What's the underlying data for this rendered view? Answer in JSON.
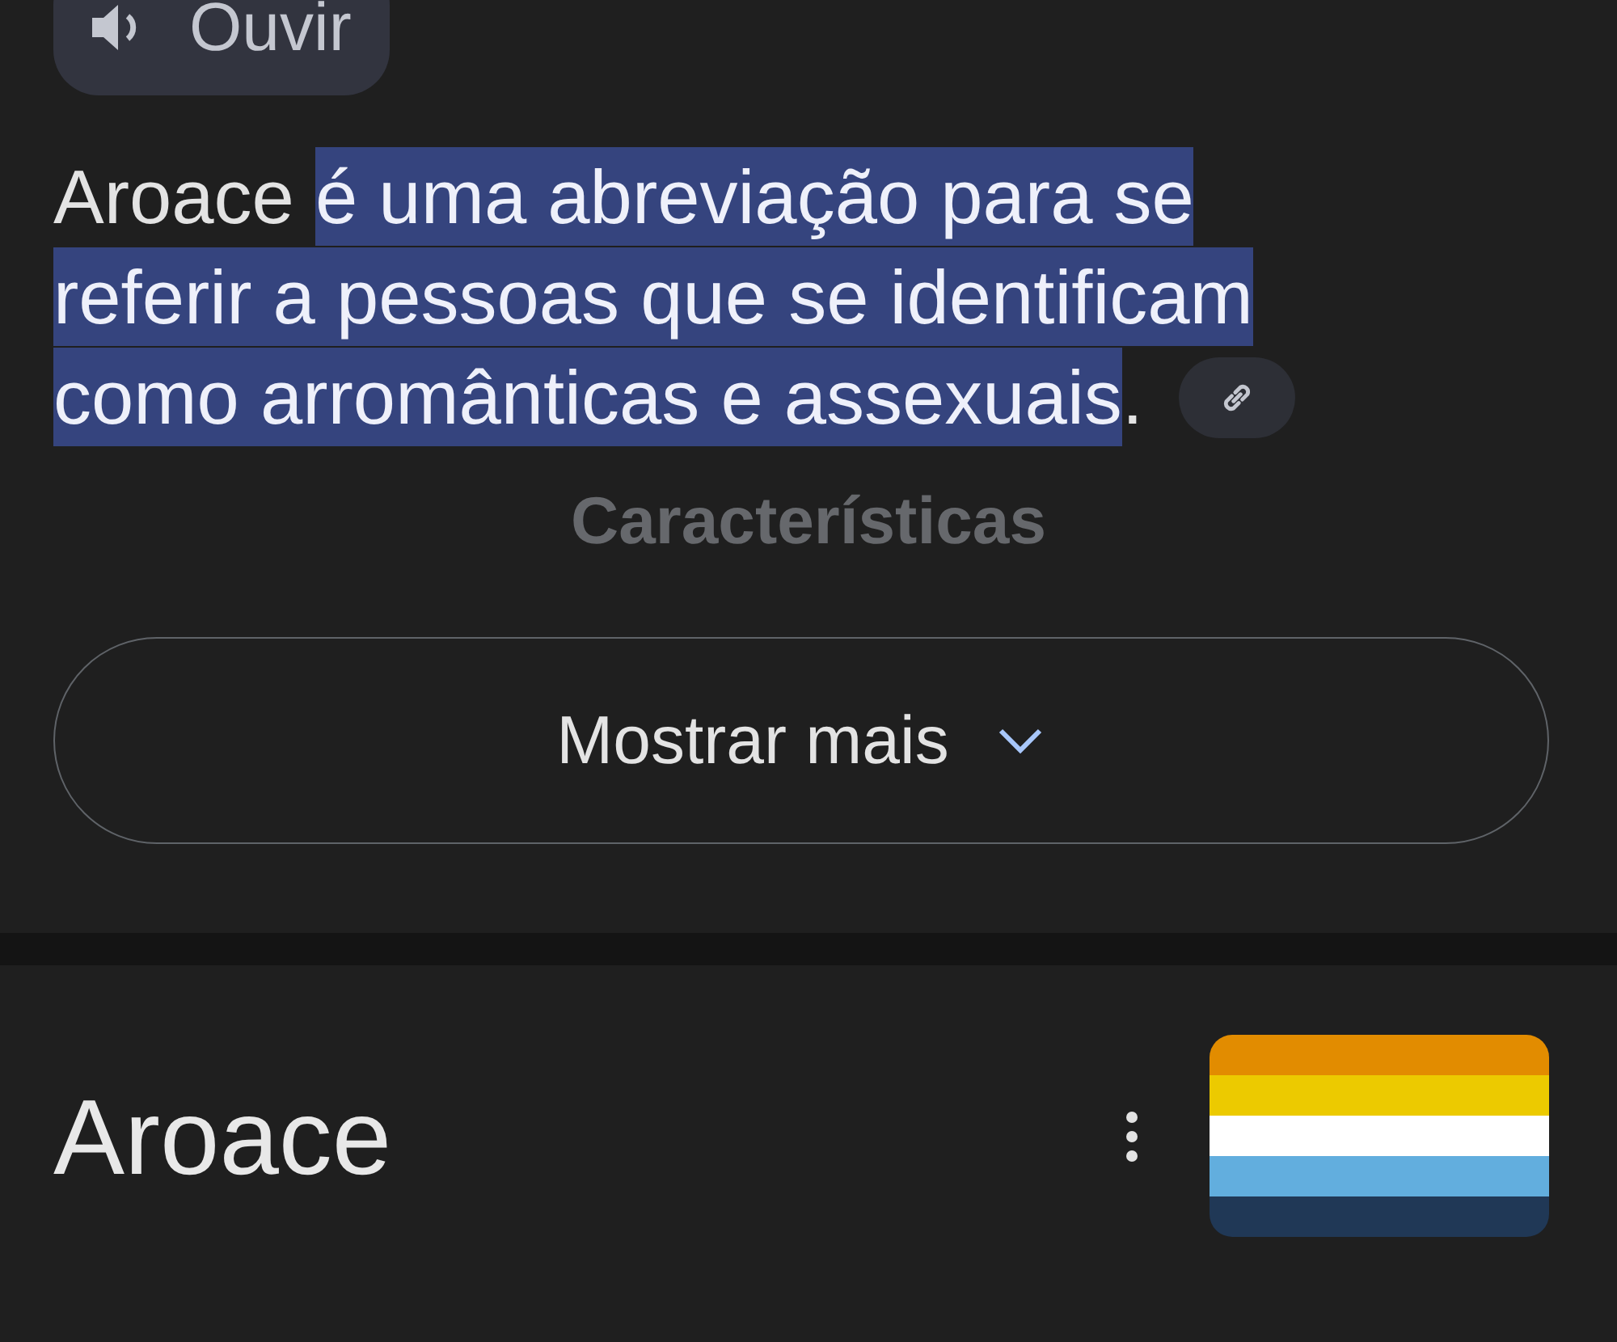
{
  "listen_button": {
    "label": "Ouvir"
  },
  "definition": {
    "segments": [
      {
        "text": "Aroace ",
        "selected": false
      },
      {
        "text": "é uma abreviação para se referir a pessoas que se identificam como arromânticas e assexuais",
        "selected": true
      },
      {
        "text": ".",
        "selected": false
      }
    ]
  },
  "section_heading": "Características",
  "show_more_button": {
    "label": "Mostrar mais"
  },
  "entity": {
    "title": "Aroace"
  }
}
